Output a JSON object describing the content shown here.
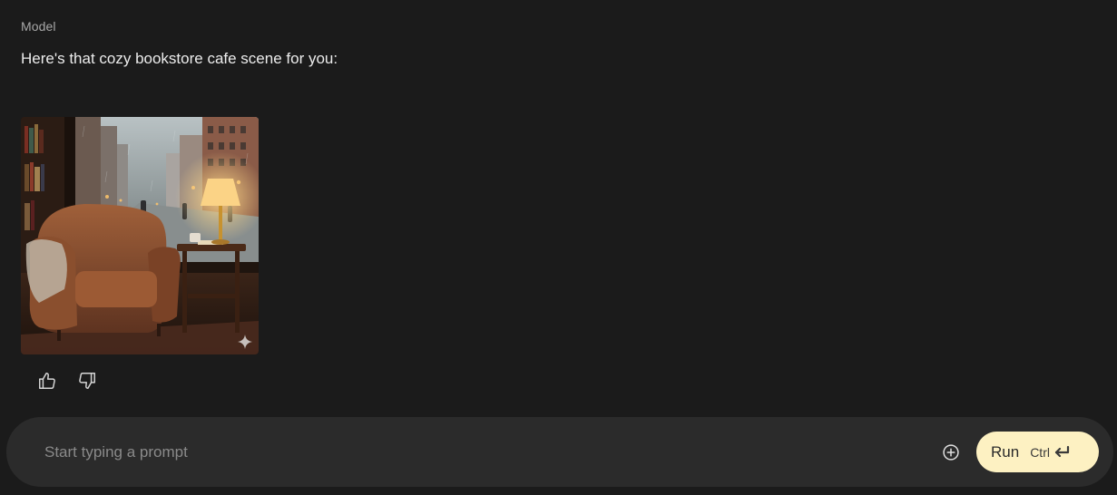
{
  "message": {
    "role_label": "Model",
    "text": "Here's that cozy bookstore cafe scene for you:",
    "image": {
      "alt": "Leather armchair beside a lamp-lit side table with coffee and a book, in front of a window overlooking a rainy city street",
      "has_sparkle_watermark": true
    }
  },
  "feedback": {
    "like_icon": "thumbs-up-icon",
    "dislike_icon": "thumbs-down-icon"
  },
  "prompt": {
    "placeholder": "Start typing a prompt",
    "value": "",
    "add_icon": "plus-circle-icon",
    "run_label": "Run",
    "shortcut_label": "Ctrl",
    "shortcut_icon": "enter-icon"
  },
  "colors": {
    "background": "#1b1b1b",
    "prompt_bar": "#2b2b2b",
    "run_button": "#fdf1c2"
  }
}
